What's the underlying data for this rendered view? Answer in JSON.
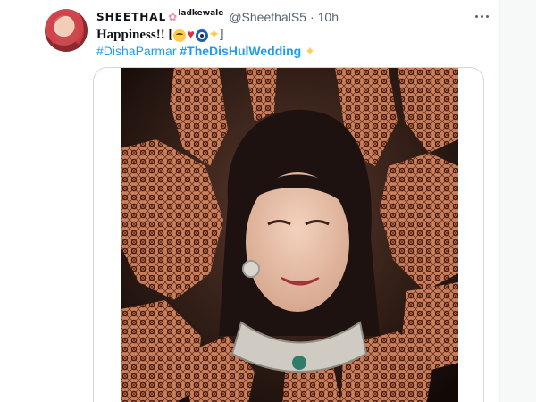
{
  "tweet": {
    "display_name": "SHEETHAL",
    "name_suffix": "ladkewale",
    "flower_icon": "cherry-blossom-icon",
    "handle": "@SheethalS5",
    "separator": "·",
    "time": "10h",
    "line1_text": "Happiness!! [",
    "line1_end": "]",
    "emojis": [
      "smiling-face-icon",
      "red-heart-icon",
      "nazar-amulet-icon",
      "sparkles-icon"
    ],
    "hashtags": [
      "#DishaParmar",
      "#TheDisHulWedding"
    ],
    "hashtag_emoji": "sparkles-icon",
    "more_icon": "more-options-icon"
  },
  "media": {
    "type": "photo",
    "subject": "smiling bride surrounded by hands with henna designs"
  },
  "colors": {
    "link": "#1d9bf0",
    "secondary_text": "#536471",
    "border": "#cfd9de"
  }
}
